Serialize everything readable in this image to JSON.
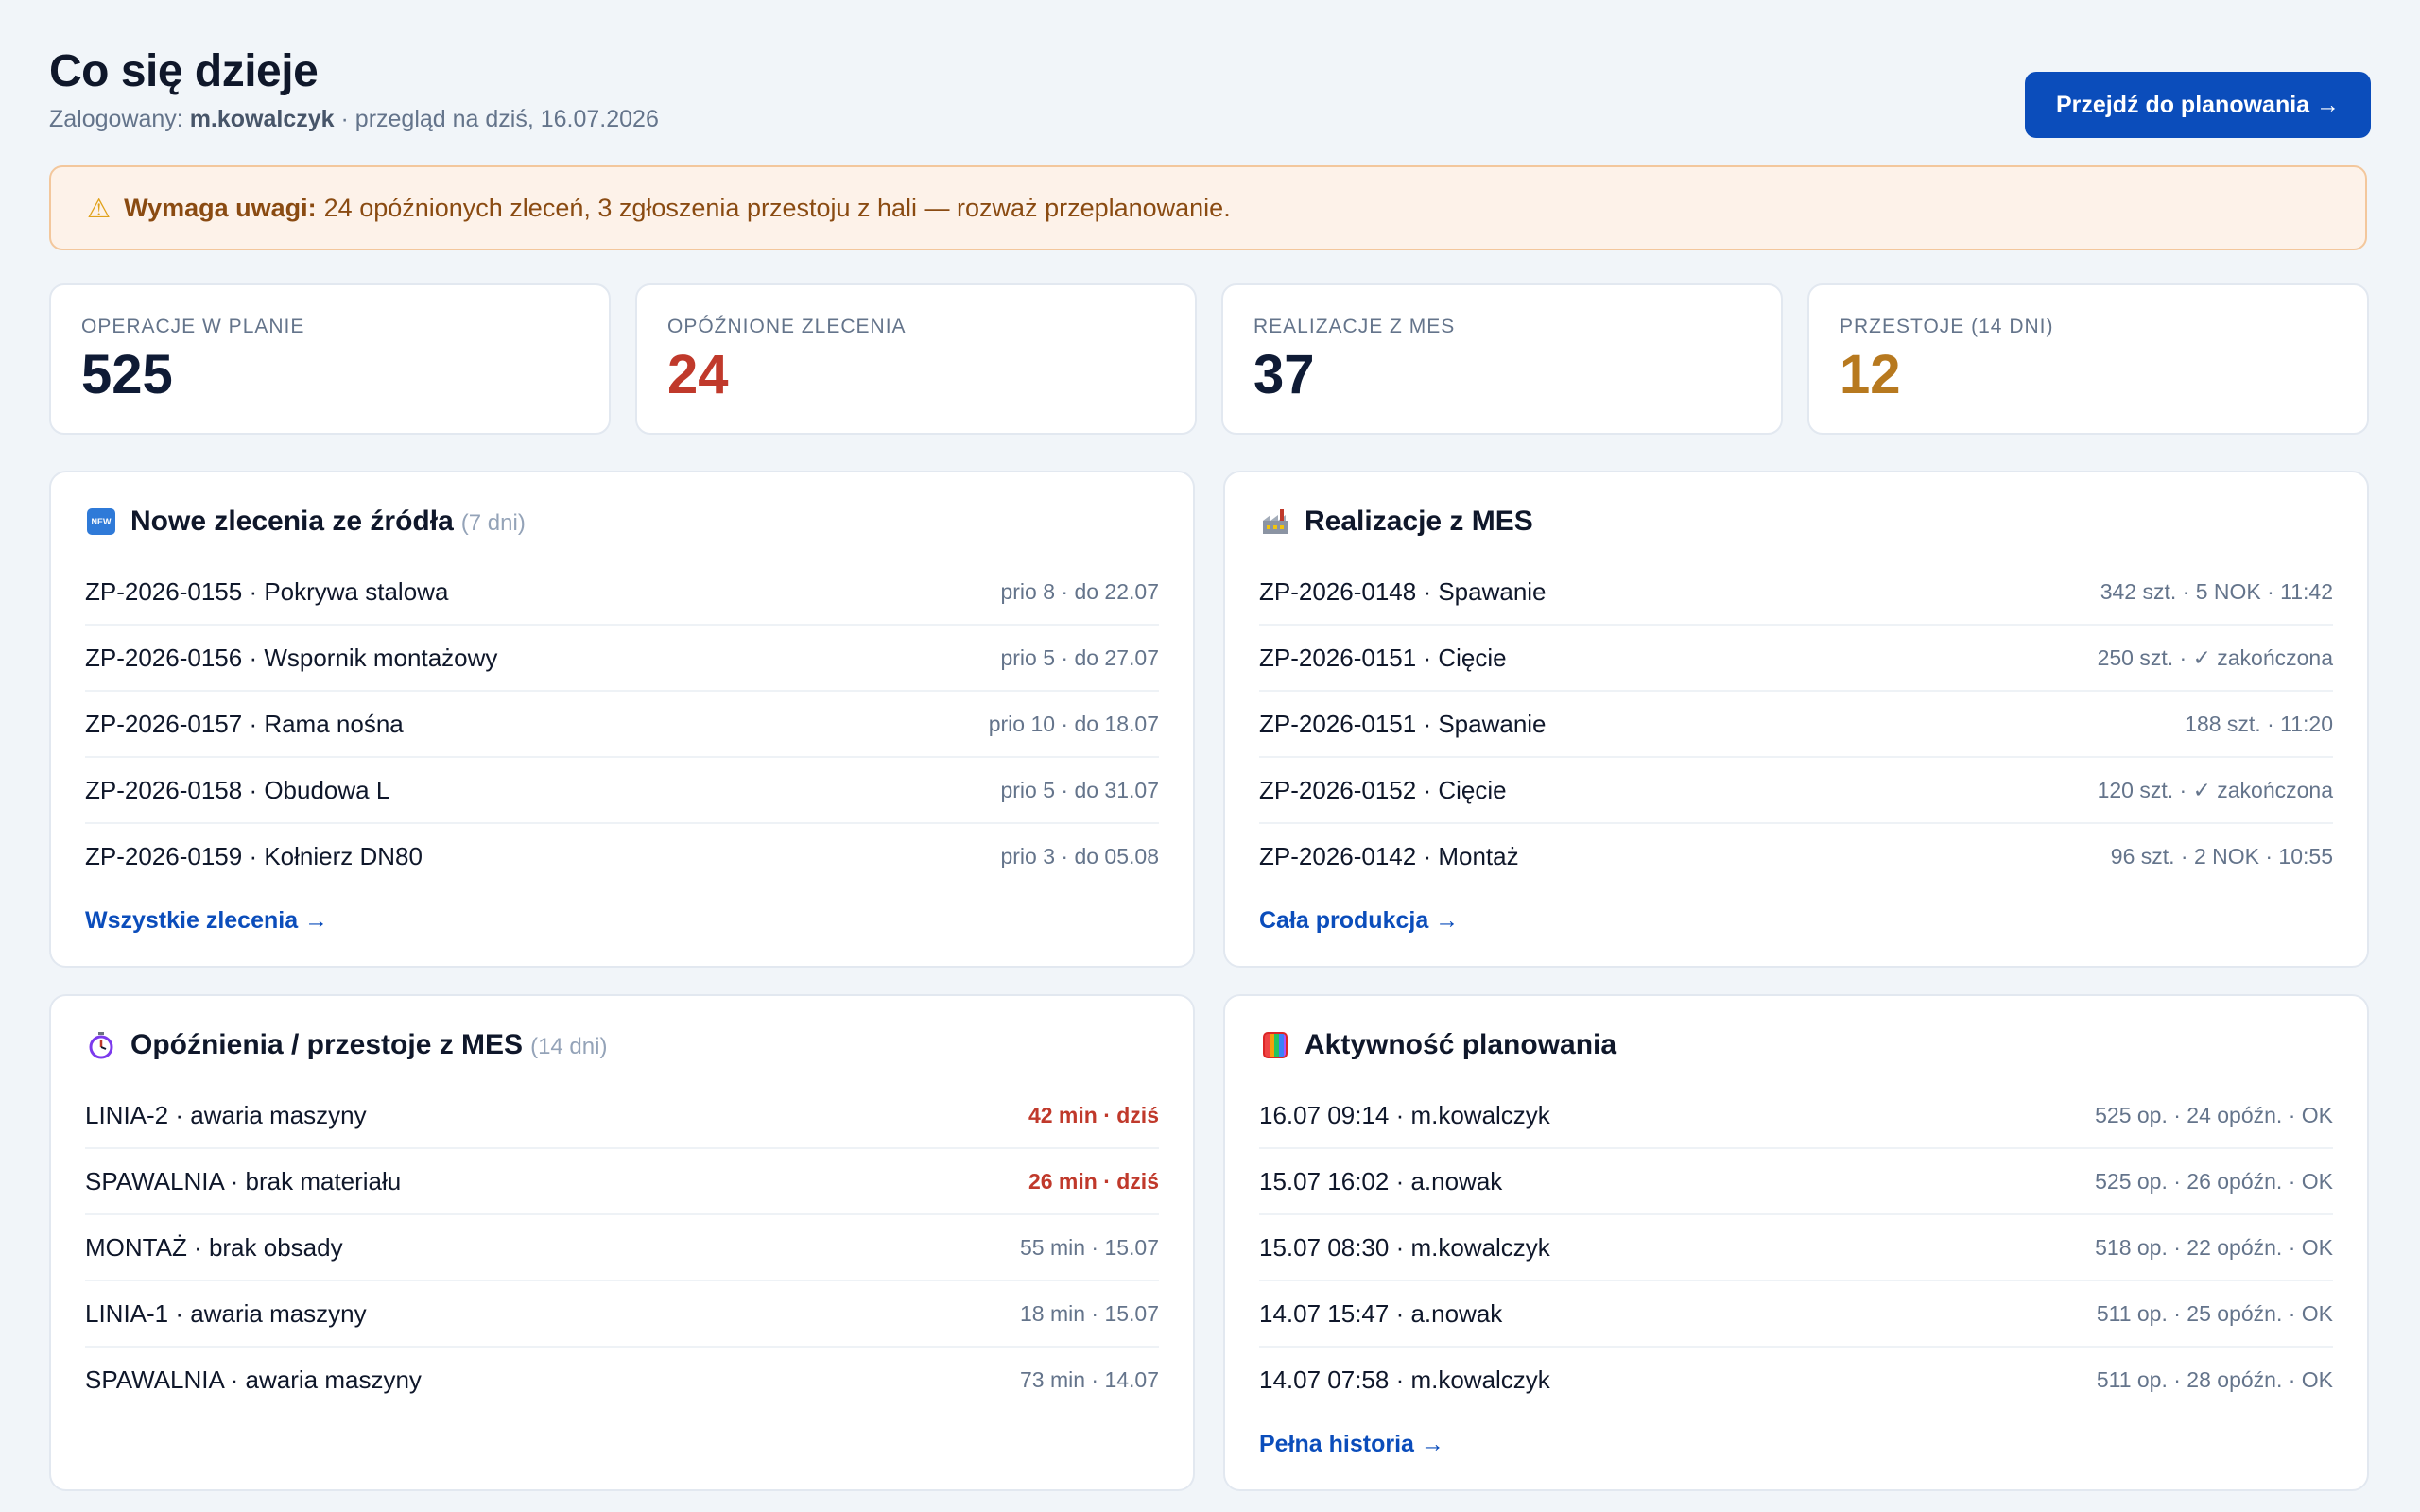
{
  "header": {
    "title": "Co się dzieje",
    "logged_prefix": "Zalogowany:",
    "user": "m.kowalczyk",
    "subtitle_rest": "· przegląd na dziś, 16.07.2026",
    "cta_label": "Przejdź do planowania →"
  },
  "alert": {
    "icon": "warning-icon",
    "strong": "Wymaga uwagi:",
    "text": "24 opóźnionych zleceń, 3 zgłoszenia przestoju z hali — rozważ przeplanowanie."
  },
  "stats": [
    {
      "label": "OPERACJE W PLANIE",
      "value": "525",
      "color": "#0f1b35"
    },
    {
      "label": "OPÓŹNIONE ZLECENIA",
      "value": "24",
      "color": "#c0392b"
    },
    {
      "label": "REALIZACJE Z MES",
      "value": "37",
      "color": "#0f1b35"
    },
    {
      "label": "PRZESTOJE (14 DNI)",
      "value": "12",
      "color": "#b7791f"
    }
  ],
  "new_orders": {
    "icon": "new-badge-icon",
    "badge": "NEW",
    "title": "Nowe zlecenia ze źródła",
    "suffix": "(7 dni)",
    "rows": [
      {
        "label": "ZP-2026-0155 · Pokrywa stalowa",
        "meta": "prio 8 · do 22.07"
      },
      {
        "label": "ZP-2026-0156 · Wspornik montażowy",
        "meta": "prio 5 · do 27.07"
      },
      {
        "label": "ZP-2026-0157 · Rama nośna",
        "meta": "prio 10 · do 18.07"
      },
      {
        "label": "ZP-2026-0158 · Obudowa L",
        "meta": "prio 5 · do 31.07"
      },
      {
        "label": "ZP-2026-0159 · Kołnierz DN80",
        "meta": "prio 3 · do 05.08"
      }
    ],
    "link": "Wszystkie zlecenia →"
  },
  "mes": {
    "icon": "factory-icon",
    "title": "Realizacje z MES",
    "rows": [
      {
        "label": "ZP-2026-0148 · Spawanie",
        "meta": "342 szt. · 5 NOK · 11:42"
      },
      {
        "label": "ZP-2026-0151 · Cięcie",
        "meta": "250 szt. · ✓ zakończona"
      },
      {
        "label": "ZP-2026-0151 · Spawanie",
        "meta": "188 szt. · 11:20"
      },
      {
        "label": "ZP-2026-0152 · Cięcie",
        "meta": "120 szt. · ✓ zakończona"
      },
      {
        "label": "ZP-2026-0142 · Montaż",
        "meta": "96 szt. · 2 NOK · 10:55"
      }
    ],
    "link": "Cała produkcja →"
  },
  "delays": {
    "icon": "stopwatch-icon",
    "title": "Opóźnienia / przestoje z MES",
    "suffix": "(14 dni)",
    "rows": [
      {
        "label": "LINIA-2 · awaria maszyny",
        "meta": "42 min · dziś"
      },
      {
        "label": "SPAWALNIA · brak materiału",
        "meta": "26 min · dziś"
      },
      {
        "label": "MONTAŻ · brak obsady",
        "meta": "55 min · 15.07"
      },
      {
        "label": "LINIA-1 · awaria maszyny",
        "meta": "18 min · 15.07"
      },
      {
        "label": "SPAWALNIA · awaria maszyny",
        "meta": "73 min · 14.07"
      }
    ]
  },
  "activity": {
    "icon": "calendar-icon",
    "title": "Aktywność planowania",
    "rows": [
      {
        "label": "16.07 09:14 · m.kowalczyk",
        "meta": "525 op. · 24 opóźn. · OK"
      },
      {
        "label": "15.07 16:02 · a.nowak",
        "meta": "525 op. · 26 opóźn. · OK"
      },
      {
        "label": "15.07 08:30 · m.kowalczyk",
        "meta": "518 op. · 22 opóźn. · OK"
      },
      {
        "label": "14.07 15:47 · a.nowak",
        "meta": "511 op. · 25 opóźn. · OK"
      },
      {
        "label": "14.07 07:58 · m.kowalczyk",
        "meta": "511 op. · 28 opóźn. · OK"
      }
    ],
    "link": "Pełna historia →"
  }
}
